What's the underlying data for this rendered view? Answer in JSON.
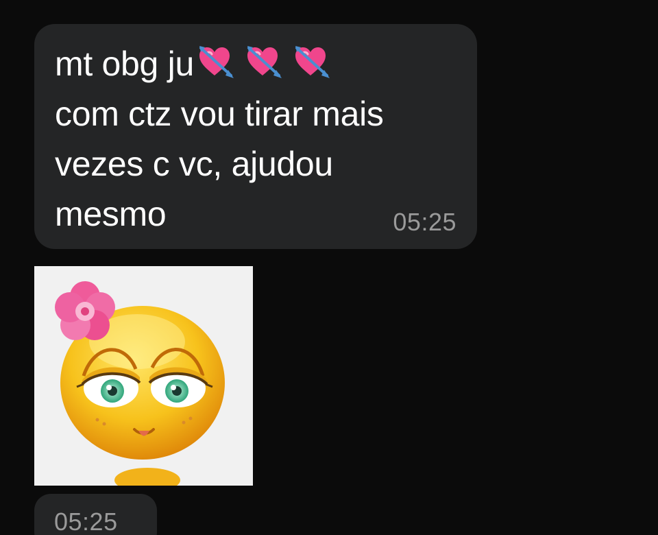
{
  "message": {
    "lines": [
      "mt obg ju",
      "com ctz vou tirar mais",
      "vezes c vc, ajudou",
      "mesmo"
    ],
    "emoji_icon": "heart-with-arrow-icon",
    "emoji_count": 3,
    "time": "05:25"
  },
  "sticker": {
    "description_icon": "smiling-emoji-with-pink-flower-sticker",
    "time": "05:25"
  },
  "colors": {
    "background": "#0b0b0b",
    "bubble": "#242526",
    "text": "#ffffff",
    "timestamp": "#9a9a9a",
    "heart": "#f0468c",
    "arrow": "#4a8fd0"
  }
}
